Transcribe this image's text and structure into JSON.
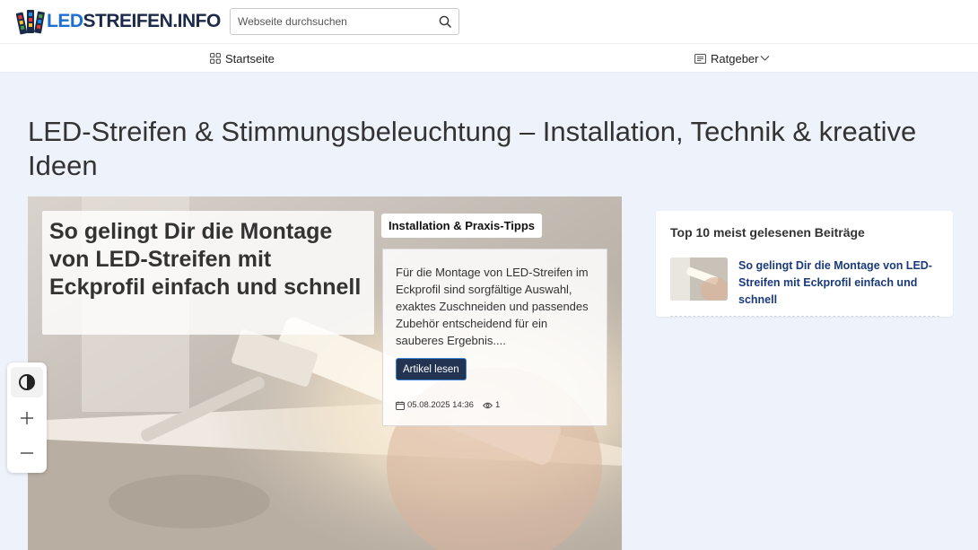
{
  "header": {
    "logo_text_highlight": "LED",
    "logo_text_rest": "STREIFEN.INFO",
    "search_placeholder": "Webseite durchsuchen"
  },
  "nav": {
    "items": [
      {
        "label": "Startseite",
        "icon": "grid-icon"
      },
      {
        "label": "Ratgeber",
        "icon": "list-icon",
        "has_dropdown": true
      }
    ]
  },
  "page": {
    "title": "LED-Streifen & Stimmungsbeleuchtung – Installation, Technik & kreative Ideen"
  },
  "hero": {
    "title": "So gelingt Dir die Montage von LED-Streifen mit Eckprofil einfach und schnell",
    "category": "Installation & Praxis-Tipps",
    "excerpt": "Für die Montage von LED-Streifen im Eckprofil sind sorgfältige Auswahl, exaktes Zuschneiden und passendes Zubehör entscheidend für ein sauberes Ergebnis....",
    "read_button": "Artikel lesen",
    "date": "05.08.2025 14:36",
    "views": "1"
  },
  "sidebar": {
    "title": "Top 10 meist gelesenen Beiträge",
    "items": [
      {
        "title": "So gelingt Dir die Montage von LED-Streifen mit Eckprofil einfach und schnell"
      }
    ]
  },
  "colors": {
    "accent": "#1d6fd1",
    "link": "#1b3a7a",
    "button": "#233352",
    "background": "#eef3fb"
  }
}
